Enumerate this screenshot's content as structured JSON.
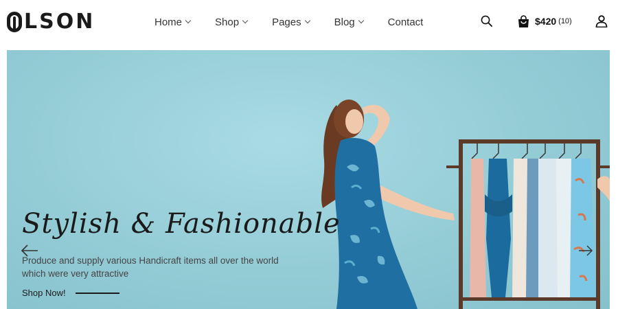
{
  "brand": {
    "name": "LSON"
  },
  "nav": {
    "items": [
      {
        "label": "Home"
      },
      {
        "label": "Shop"
      },
      {
        "label": "Pages"
      },
      {
        "label": "Blog"
      },
      {
        "label": "Contact"
      }
    ]
  },
  "header": {
    "cart_price": "$420",
    "cart_count": "(10)",
    "icons": [
      "search-icon",
      "shopping-bag-icon",
      "user-icon"
    ]
  },
  "hero": {
    "title": "Stylish & Fashionable",
    "description": "Produce and supply various Handicraft items all over the world which were very attractive",
    "cta_label": "Shop Now!",
    "arrows": [
      "arrow-left-icon",
      "arrow-right-icon"
    ]
  },
  "colors": {
    "hero_bg": "#94ccd6",
    "text_dark": "#1a1a1a",
    "dress_blue": "#1f6fa3"
  }
}
